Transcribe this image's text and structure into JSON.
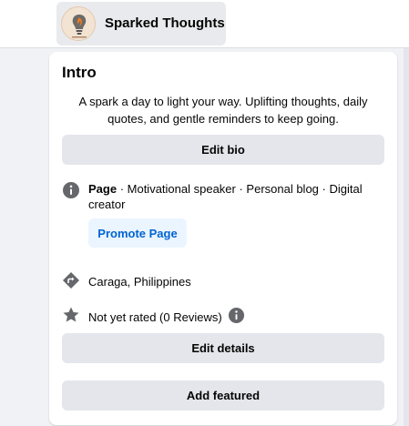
{
  "header": {
    "page_name": "Sparked Thoughts"
  },
  "intro": {
    "title": "Intro",
    "bio": "A spark a day to light your way. Uplifting thoughts, daily quotes, and gentle reminders to keep going.",
    "edit_bio_label": "Edit bio",
    "category_prefix": "Page",
    "category_line1": " · Motivational speaker · Personal blog · Digital",
    "category_line2": "creator",
    "promote_label": "Promote Page",
    "location": "Caraga, Philippines",
    "rating": "Not yet rated (0 Reviews)",
    "edit_details_label": "Edit details",
    "add_featured_label": "Add featured"
  },
  "colors": {
    "accent_blue": "#0064d1",
    "icon_gray": "#65676b",
    "button_gray": "#e4e6eb"
  }
}
